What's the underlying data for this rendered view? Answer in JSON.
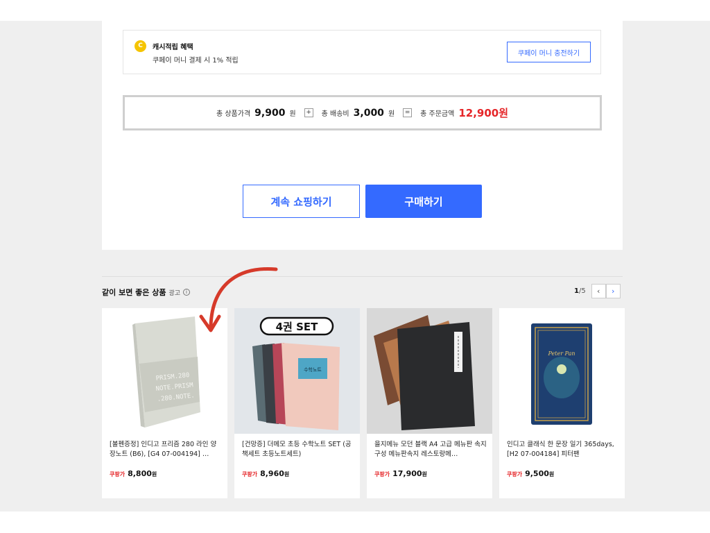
{
  "cash": {
    "icon": "C",
    "title": "캐시적립 혜택",
    "desc": "쿠페이 머니 결제 시 1% 적립",
    "charge_button": "쿠페이 머니 충전하기"
  },
  "totals": {
    "product_label": "총 상품가격",
    "product_value": "9,900",
    "won1": "원",
    "plus": "+",
    "shipping_label": "총 배송비",
    "shipping_value": "3,000",
    "won2": "원",
    "equals": "=",
    "order_label": "총 주문금액",
    "order_value": "12,900원"
  },
  "actions": {
    "continue_label": "계속 쇼핑하기",
    "buy_label": "구매하기"
  },
  "recommend": {
    "title": "같이 보면 좋은 상품",
    "ad_label": "광고",
    "info_icon": "i",
    "page_current": "1",
    "page_total": "/5",
    "prev_icon": "‹",
    "next_icon": "›",
    "products": [
      {
        "name": "[볼펜증정] 인디고 프리즘 280 라인 양장노트 (B6), [G4 07-004194] …",
        "price_tag": "쿠팡가",
        "price": "8,800",
        "unit": "원",
        "cover_text": "PRISM.280 NOTE.PRISM .280.NOTE."
      },
      {
        "name": "[건망증] 더메모 초등 수학노트 SET (공책세트 초등노트세트)",
        "price_tag": "쿠팡가",
        "price": "8,960",
        "unit": "원",
        "badge": "4권 SET",
        "cover_text": "수학노트"
      },
      {
        "name": "을지메뉴 모던 블랙 A4 고급 메뉴판 속지 구성 메뉴판속지 레스토랑메…",
        "price_tag": "쿠팡가",
        "price": "17,900",
        "unit": "원"
      },
      {
        "name": "인디고 클래식 한 문장 일기 365days, [H2 07-004184] 피터팬",
        "price_tag": "쿠팡가",
        "price": "9,500",
        "unit": "원",
        "cover_text": "Peter Pan"
      }
    ]
  },
  "colors": {
    "accent": "#346aff",
    "price_red": "#e52528",
    "coin": "#f5c400",
    "arrow": "#d63a2a"
  }
}
